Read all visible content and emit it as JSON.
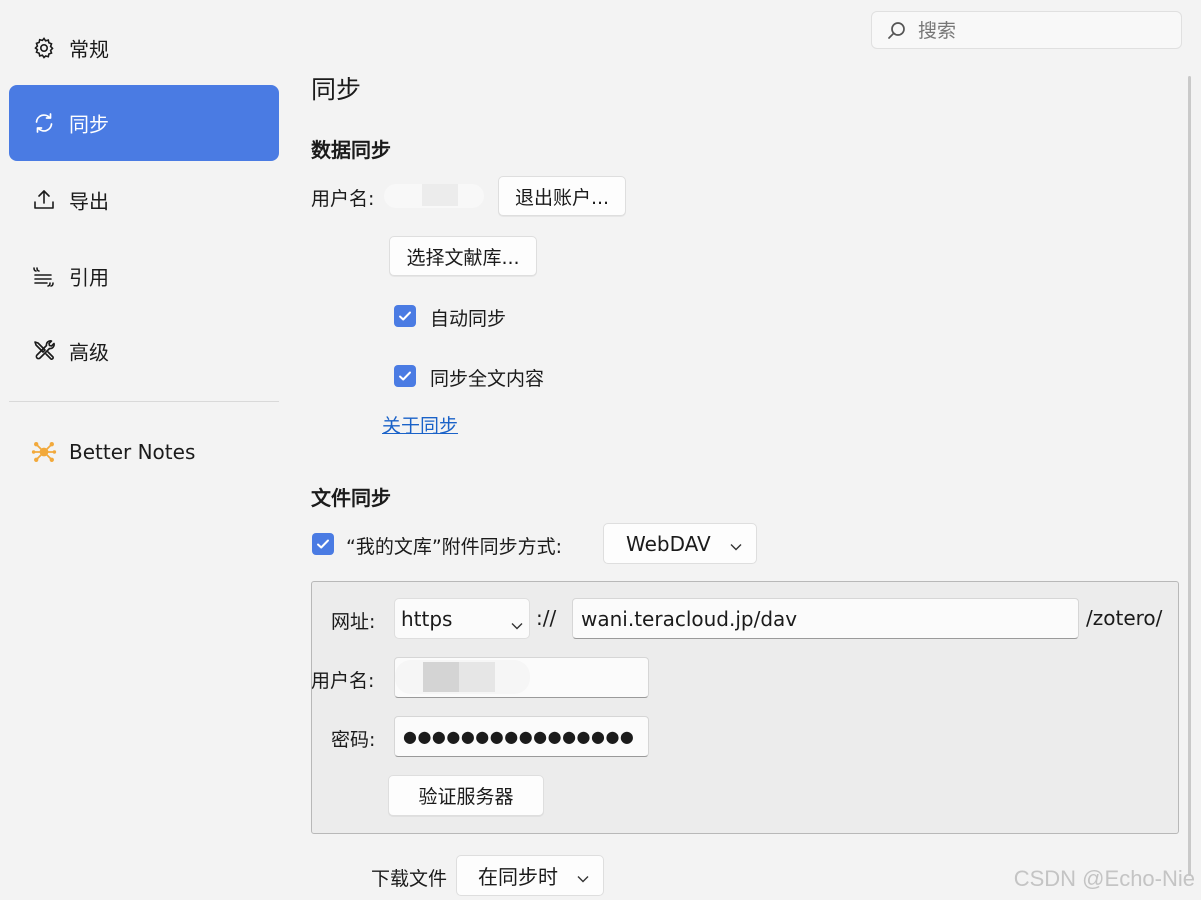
{
  "sidebar": {
    "items": [
      {
        "label": "常规",
        "icon": "gear-icon"
      },
      {
        "label": "同步",
        "icon": "sync-icon",
        "active": true
      },
      {
        "label": "导出",
        "icon": "upload-icon"
      },
      {
        "label": "引用",
        "icon": "quote-icon"
      },
      {
        "label": "高级",
        "icon": "tools-icon"
      }
    ],
    "plugin": {
      "label": "Better Notes",
      "icon": "better-notes-logo-icon"
    }
  },
  "search": {
    "placeholder": "搜索",
    "value": ""
  },
  "page_title": "同步",
  "data_sync": {
    "heading": "数据同步",
    "username_label": "用户名:",
    "logout_button": "退出账户...",
    "choose_library_button": "选择文献库...",
    "auto_sync_label": "自动同步",
    "auto_sync_checked": true,
    "fulltext_label": "同步全文内容",
    "fulltext_checked": true,
    "about_link": "关于同步"
  },
  "file_sync": {
    "heading": "文件同步",
    "library_checked": true,
    "library_label": "“我的文库”附件同步方式:",
    "method_value": "WebDAV",
    "url_label": "网址:",
    "protocol_value": "https",
    "protocol_sep": "://",
    "url_value": "wani.teracloud.jp/dav",
    "url_suffix": "/zotero/",
    "username_label": "用户名:",
    "password_label": "密码:",
    "password_value": "●●●●●●●●●●●●●●●●",
    "verify_button": "验证服务器",
    "download_label": "下载文件",
    "download_value": "在同步时"
  },
  "colors": {
    "accent": "#4a7be3",
    "link": "#1a62c8",
    "background": "#f3f3f3"
  },
  "watermark": "CSDN @Echo-Nie"
}
